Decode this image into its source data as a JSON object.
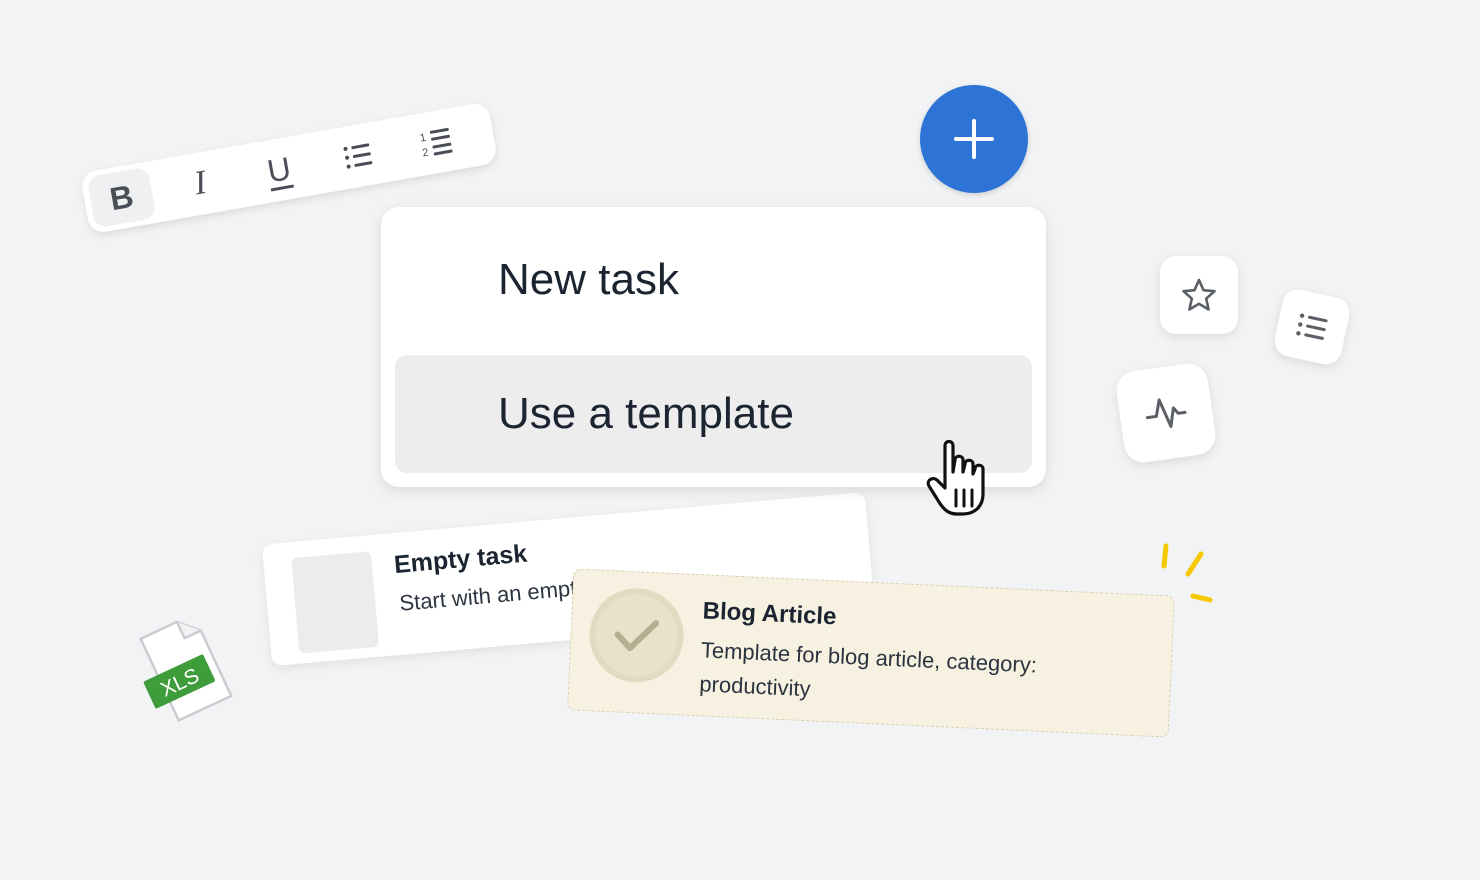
{
  "toolbar": {
    "bold_label": "B",
    "italic_label": "I",
    "underline_label": "U",
    "buttons": [
      "bold-icon",
      "italic-icon",
      "underline-icon",
      "bulleted-list-icon",
      "numbered-list-icon"
    ],
    "numbered_list_digits": [
      "1",
      "2"
    ]
  },
  "fab": {
    "icon": "plus-icon",
    "color": "#2e74d6"
  },
  "menu": {
    "items": [
      {
        "label": "New task"
      },
      {
        "label": "Use a template",
        "highlighted": true
      }
    ]
  },
  "cards": {
    "empty_task": {
      "title": "Empty task",
      "subtitle": "Start with an empty task"
    },
    "blog_article": {
      "title": "Blog Article",
      "description": "Template for blog article, category: productivity"
    }
  },
  "tiles": [
    "star-icon",
    "list-icon",
    "pulse-icon"
  ],
  "file": {
    "label": "XLS",
    "badge_color": "#3f9c3a"
  },
  "colors": {
    "accent": "#2e74d6",
    "sparkle": "#f5c800",
    "card_bg": "#f6f1e1"
  }
}
